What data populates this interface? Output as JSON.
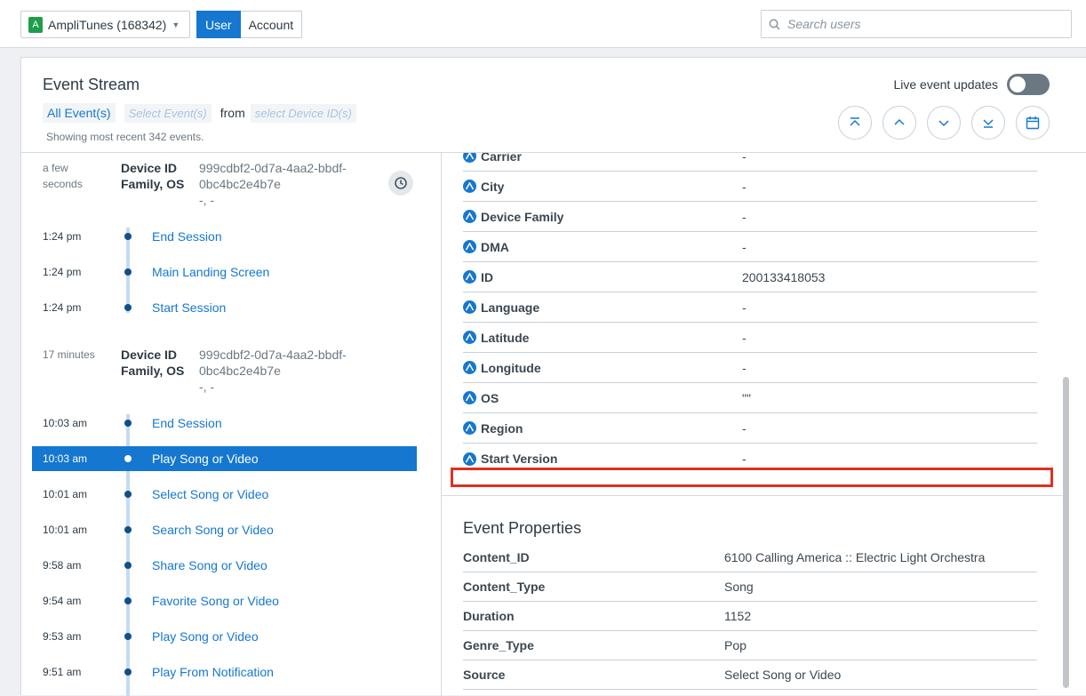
{
  "topbar": {
    "project_badge": "A",
    "project_name": "AmpliTunes (168342)",
    "seg_user": "User",
    "seg_account": "Account",
    "search_placeholder": "Search users"
  },
  "header": {
    "title": "Event Stream",
    "all_events": "All Event(s)",
    "select_events": "Select Event(s)",
    "from": "from",
    "select_device": "select Device ID(s)",
    "showing": "Showing most recent 342 events.",
    "live_label": "Live event updates",
    "live_enabled": false
  },
  "sessions": [
    {
      "time": "a few seconds",
      "label": "Device ID Family, OS",
      "value_line1": "999cdbf2-0d7a-4aa2-bbdf-0bc4bc2e4b7e",
      "value_line2": "-, -",
      "events": [
        {
          "time": "1:24 pm",
          "name": "End Session"
        },
        {
          "time": "1:24 pm",
          "name": "Main Landing Screen"
        },
        {
          "time": "1:24 pm",
          "name": "Start Session"
        }
      ]
    },
    {
      "time": "17 minutes",
      "label": "Device ID Family, OS",
      "value_line1": "999cdbf2-0d7a-4aa2-bbdf-0bc4bc2e4b7e",
      "value_line2": "-, -",
      "events": [
        {
          "time": "10:03 am",
          "name": "End Session"
        },
        {
          "time": "10:03 am",
          "name": "Play Song or Video",
          "selected": true
        },
        {
          "time": "10:01 am",
          "name": "Select Song or Video"
        },
        {
          "time": "10:01 am",
          "name": "Search Song or Video"
        },
        {
          "time": "9:58 am",
          "name": "Share Song or Video"
        },
        {
          "time": "9:54 am",
          "name": "Favorite Song or Video"
        },
        {
          "time": "9:53 am",
          "name": "Play Song or Video"
        },
        {
          "time": "9:51 am",
          "name": "Play From Notification"
        }
      ]
    }
  ],
  "user_properties": [
    {
      "key": "Carrier",
      "value": "-"
    },
    {
      "key": "City",
      "value": "-"
    },
    {
      "key": "Device Family",
      "value": "-"
    },
    {
      "key": "DMA",
      "value": "-"
    },
    {
      "key": "ID",
      "value": "200133418053"
    },
    {
      "key": "Language",
      "value": "-"
    },
    {
      "key": "Latitude",
      "value": "-"
    },
    {
      "key": "Longitude",
      "value": "-"
    },
    {
      "key": "OS",
      "value": "\"\""
    },
    {
      "key": "Region",
      "value": "-"
    },
    {
      "key": "Start Version",
      "value": "-"
    }
  ],
  "event_properties_title": "Event Properties",
  "event_properties": [
    {
      "key": "Content_ID",
      "value": "6100 Calling America :: Electric Light Orchestra"
    },
    {
      "key": "Content_Type",
      "value": "Song"
    },
    {
      "key": "Duration",
      "value": "1152"
    },
    {
      "key": "Genre_Type",
      "value": "Pop"
    },
    {
      "key": "Source",
      "value": "Select Song or Video"
    }
  ]
}
